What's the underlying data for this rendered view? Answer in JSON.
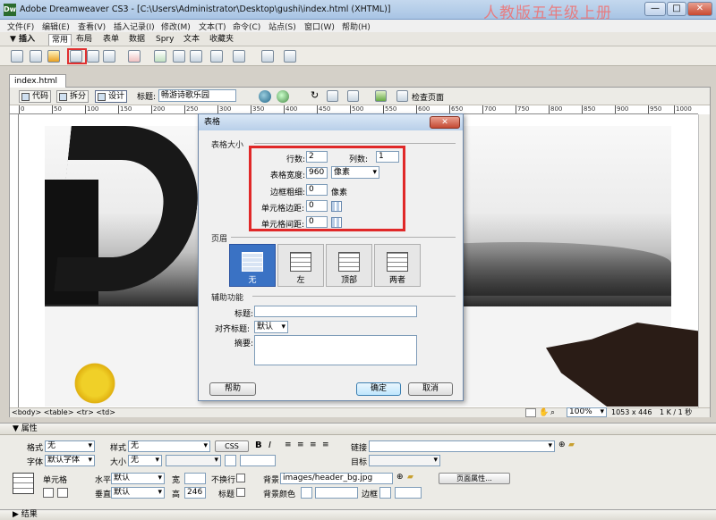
{
  "window": {
    "app_icon": "Dw",
    "title": "Adobe Dreamweaver CS3 - [C:\\Users\\Administrator\\Desktop\\gushi\\index.html (XHTML)]",
    "watermark": "人教版五年级上册",
    "min_label": "—",
    "max_label": "□",
    "close_label": "✕"
  },
  "menu": [
    "文件(F)",
    "编辑(E)",
    "查看(V)",
    "插入记录(I)",
    "修改(M)",
    "文本(T)",
    "命令(C)",
    "站点(S)",
    "窗口(W)",
    "帮助(H)"
  ],
  "insert_bar": {
    "head": "▼ 插入",
    "tabs": [
      "常用",
      "布局",
      "表单",
      "数据",
      "Spry",
      "文本",
      "收藏夹"
    ],
    "active_tab": "常用"
  },
  "document": {
    "tab": "index.html",
    "view_buttons": [
      "代码",
      "拆分",
      "设计"
    ],
    "active_view": "设计",
    "title_label": "标题:",
    "title_value": "畅游诗歌乐园",
    "check_page": "检查页面",
    "ruler_ticks": [
      "0",
      "50",
      "100",
      "150",
      "200",
      "250",
      "300",
      "350",
      "400",
      "450",
      "500",
      "550",
      "600",
      "650",
      "700",
      "750",
      "800",
      "850",
      "900",
      "950",
      "1000"
    ],
    "tag_path": "<body> <table> <tr> <td>",
    "zoom": "100%",
    "size": "1053 x 446",
    "filesize": "1 K / 1 秒"
  },
  "dialog": {
    "title": "表格",
    "close": "✕",
    "group_size": "表格大小",
    "rows_label": "行数:",
    "rows_value": "2",
    "cols_label": "列数:",
    "cols_value": "1",
    "width_label": "表格宽度:",
    "width_value": "960",
    "width_unit": "像素",
    "border_label": "边框粗细:",
    "border_value": "0",
    "border_unit": "像素",
    "padding_label": "单元格边距:",
    "padding_value": "0",
    "spacing_label": "单元格间距:",
    "spacing_value": "0",
    "group_header": "页眉",
    "header_options": [
      "无",
      "左",
      "顶部",
      "两者"
    ],
    "selected_header": "无",
    "group_access": "辅助功能",
    "caption_label": "标题:",
    "caption_value": "",
    "align_caption_label": "对齐标题:",
    "align_caption_value": "默认",
    "summary_label": "摘要:",
    "help": "帮助",
    "ok": "确定",
    "cancel": "取消"
  },
  "properties": {
    "head": "▼ 属性",
    "format_label": "格式",
    "format_value": "无",
    "style_label": "样式",
    "style_value": "无",
    "css_btn": "CSS",
    "bold": "B",
    "italic": "I",
    "link_label": "链接",
    "font_label": "字体",
    "font_value": "默认字体",
    "size_label": "大小",
    "size_value": "无",
    "target_label": "目标",
    "cell_label": "单元格",
    "horz_label": "水平",
    "horz_value": "默认",
    "width_label": "宽",
    "nowrap_label": "不换行",
    "bg_label": "背景",
    "bg_value": "images/header_bg.jpg",
    "page_props": "页面属性...",
    "vert_label": "垂直",
    "vert_value": "默认",
    "height_label": "高",
    "height_value": "246",
    "header_label": "标题",
    "bgcolor_label": "背景颜色",
    "border_label": "边框"
  },
  "results_bar": "▶ 结果"
}
